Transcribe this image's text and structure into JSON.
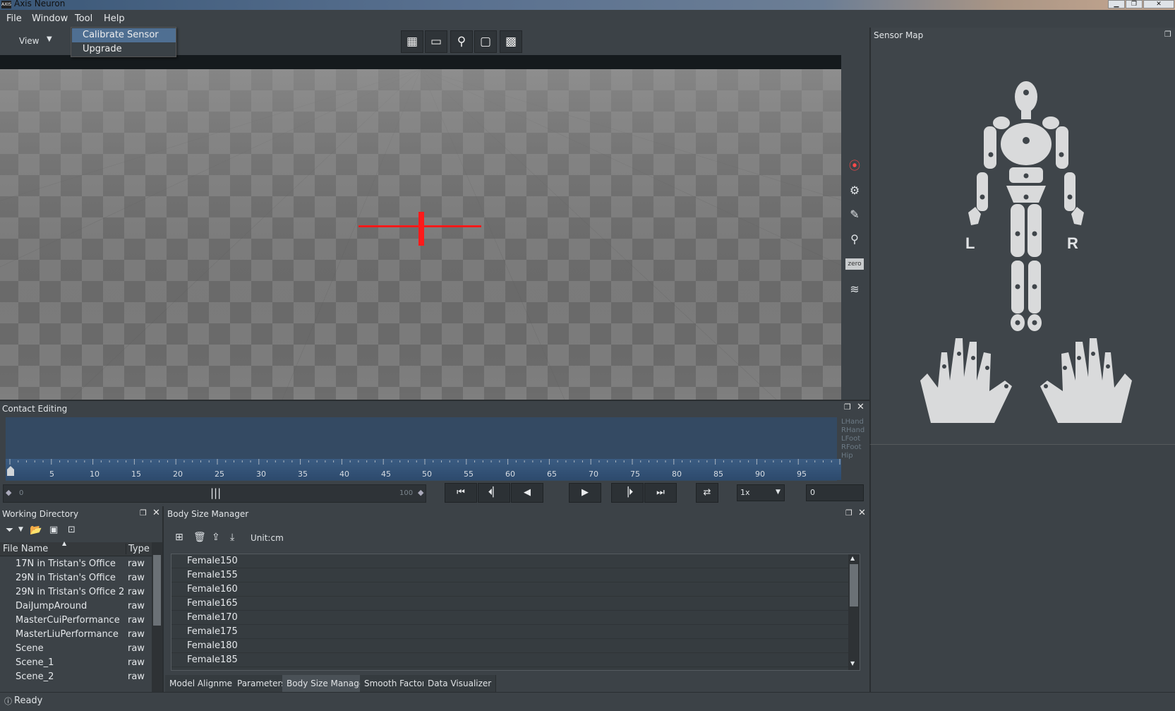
{
  "window": {
    "title": "Axis Neuron",
    "logo_text": "AXIS"
  },
  "menu": {
    "file": "File",
    "window": "Window",
    "tool": "Tool",
    "help": "Help"
  },
  "tool_menu": {
    "items": [
      "Calibrate Sensor",
      "Upgrade"
    ]
  },
  "toolbar": {
    "view_label": "View"
  },
  "panels": {
    "sensor_map": "Sensor Map",
    "contact_editing": "Contact Editing",
    "working_directory": "Working Directory",
    "body_size_manager": "Body Size Manager"
  },
  "sensor_map": {
    "left_label": "L",
    "right_label": "R"
  },
  "side_tools": {
    "zero_label": "zero"
  },
  "contact": {
    "channels": [
      "LHand",
      "RHand",
      "LFoot",
      "RFoot",
      "Hip"
    ],
    "ticks": [
      "5",
      "10",
      "15",
      "20",
      "25",
      "30",
      "35",
      "40",
      "45",
      "50",
      "55",
      "60",
      "65",
      "70",
      "75",
      "80",
      "85",
      "90",
      "95"
    ],
    "range_start": "0",
    "range_end": "100",
    "speed": "1x",
    "frame": "0"
  },
  "working_directory": {
    "columns": {
      "name": "File Name",
      "type": "Type"
    },
    "rows": [
      {
        "name": "17N in Tristan's Office",
        "type": "raw"
      },
      {
        "name": "29N in Tristan's Office",
        "type": "raw"
      },
      {
        "name": "29N in Tristan's Office 2",
        "type": "raw"
      },
      {
        "name": "DaiJumpAround",
        "type": "raw"
      },
      {
        "name": "MasterCuiPerformance",
        "type": "raw"
      },
      {
        "name": "MasterLiuPerformance",
        "type": "raw"
      },
      {
        "name": "Scene",
        "type": "raw"
      },
      {
        "name": "Scene_1",
        "type": "raw"
      },
      {
        "name": "Scene_2",
        "type": "raw"
      }
    ]
  },
  "body_size_manager": {
    "unit_label": "Unit:cm",
    "items": [
      "Female150",
      "Female155",
      "Female160",
      "Female165",
      "Female170",
      "Female175",
      "Female180",
      "Female185"
    ]
  },
  "bottom_tabs": [
    "Model Alignment",
    "Parameters",
    "Body Size Manager",
    "Smooth Factor",
    "Data Visualizer"
  ],
  "status": {
    "text": "Ready"
  },
  "colors": {
    "crosshair": "#ff1a1a",
    "timeline": "#344a63",
    "panel_bg": "#3c4247",
    "body_map": "#d9dadb"
  }
}
